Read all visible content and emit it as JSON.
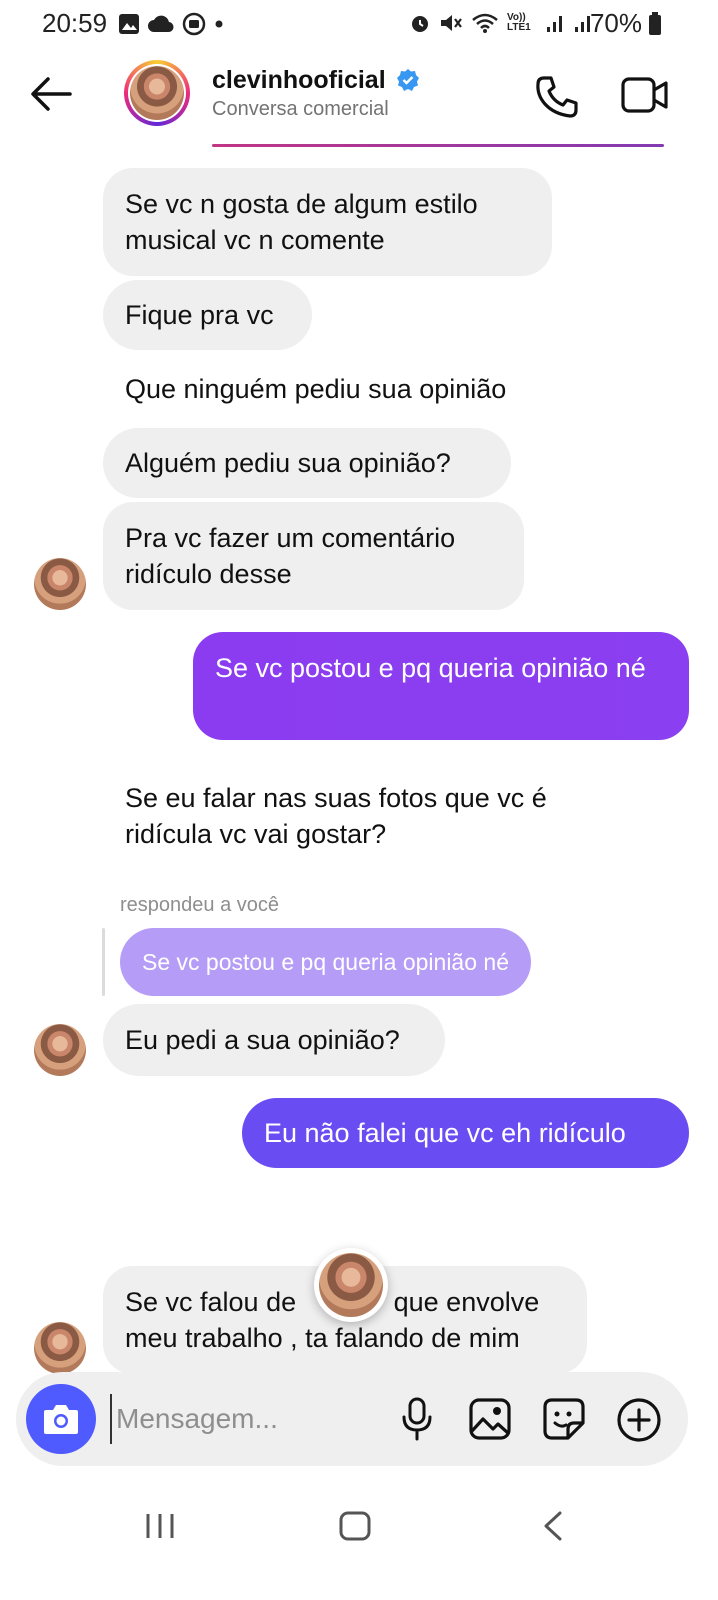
{
  "status_bar": {
    "time": "20:59",
    "battery": "70%",
    "left_icons": [
      "image-icon",
      "cloud-icon",
      "media-icon",
      "dot-icon"
    ],
    "right_icons": [
      "alarm-icon",
      "mute-icon",
      "wifi-icon",
      "volte-icon",
      "signal-icon",
      "signal-icon",
      "battery-icon"
    ],
    "network_label": "Vo)) LTE1"
  },
  "header": {
    "contact_name": "clevinhooficial",
    "subtitle": "Conversa comercial",
    "verified": true
  },
  "messages": [
    {
      "side": "in",
      "text": "Se vc n gosta de algum estilo musical vc n comente"
    },
    {
      "side": "in",
      "text": "Fique pra vc"
    },
    {
      "side": "in-plain",
      "text": "Que ninguém pediu sua opinião"
    },
    {
      "side": "in",
      "text": "Alguém pediu sua opinião?"
    },
    {
      "side": "in",
      "text": "Pra vc fazer um comentário ridículo desse"
    },
    {
      "side": "out",
      "text": "Se vc postou e pq queria opinião né"
    },
    {
      "side": "in-plain",
      "text": "Se eu falar nas suas fotos que vc é ridícula vc vai gostar?"
    },
    {
      "side": "in",
      "text": "Eu pedi a sua opinião?"
    },
    {
      "side": "out",
      "text": "Eu não falei que vc eh ridículo"
    },
    {
      "side": "in",
      "text": "Se vc falou de             que envolve meu trabalho , ta falando de mim"
    }
  ],
  "reply": {
    "label": "respondeu a você",
    "quoted_text": "Se vc postou e pq queria opinião né"
  },
  "composer": {
    "placeholder": "Mensagem..."
  },
  "colors": {
    "out_bubble_1": "#8a3ff0",
    "out_bubble_2": "#6a4cf3",
    "in_bubble": "#efefef",
    "camera_button": "#4f5bff",
    "reply_quote": "#b59cf7"
  }
}
